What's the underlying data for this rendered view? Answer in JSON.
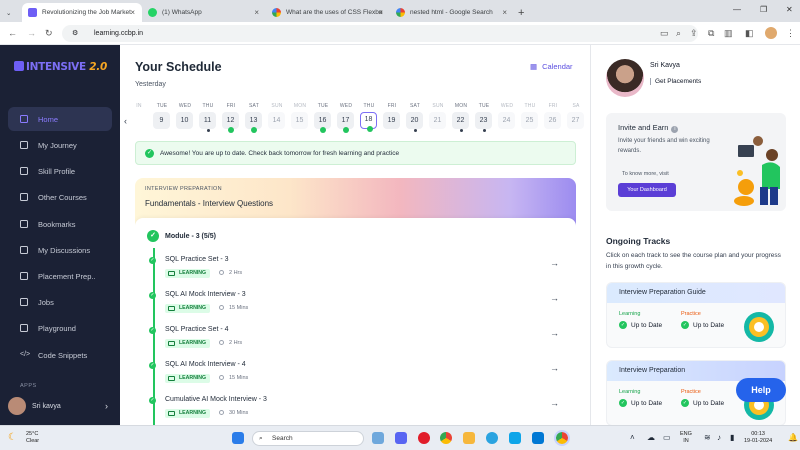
{
  "browser": {
    "tabs": [
      {
        "title": "Revolutionizing the Job Market",
        "icon": "ccbp-icon",
        "active": true
      },
      {
        "title": "(1) WhatsApp",
        "icon": "whatsapp-icon",
        "active": false
      },
      {
        "title": "What are the uses of CSS Flexbo",
        "icon": "google-icon",
        "active": false
      },
      {
        "title": "nested html - Google Search",
        "icon": "google-icon",
        "active": false
      }
    ],
    "url": "learning.ccbp.in"
  },
  "sidebar": {
    "brand": "INTENSIVE",
    "brand_version": "2.0",
    "items": [
      {
        "label": "Home",
        "icon": "home-icon"
      },
      {
        "label": "My Journey",
        "icon": "journey-icon"
      },
      {
        "label": "Skill Profile",
        "icon": "chart-icon"
      },
      {
        "label": "Other Courses",
        "icon": "book-icon"
      },
      {
        "label": "Bookmarks",
        "icon": "bookmark-icon"
      },
      {
        "label": "My Discussions",
        "icon": "chat-icon"
      },
      {
        "label": "Placement Prep..",
        "icon": "briefcase-icon"
      },
      {
        "label": "Jobs",
        "icon": "jobs-icon"
      },
      {
        "label": "Playground",
        "icon": "playground-icon"
      },
      {
        "label": "Code Snippets",
        "icon": "code-icon"
      }
    ],
    "apps_label": "APPS",
    "user_name": "Sri kavya"
  },
  "schedule": {
    "title": "Your Schedule",
    "subtitle": "Yesterday",
    "calendar_label": "Calendar",
    "days": [
      {
        "name": "IN",
        "num": "",
        "state": "dim"
      },
      {
        "name": "TUE",
        "num": "9",
        "state": "normal"
      },
      {
        "name": "WED",
        "num": "10",
        "state": "normal"
      },
      {
        "name": "THU",
        "num": "11",
        "state": "dot"
      },
      {
        "name": "FRI",
        "num": "12",
        "state": "check"
      },
      {
        "name": "SAT",
        "num": "13",
        "state": "check"
      },
      {
        "name": "SUN",
        "num": "14",
        "state": "dim"
      },
      {
        "name": "MON",
        "num": "15",
        "state": "dim"
      },
      {
        "name": "TUE",
        "num": "16",
        "state": "check"
      },
      {
        "name": "WED",
        "num": "17",
        "state": "check"
      },
      {
        "name": "THU",
        "num": "18",
        "state": "selected"
      },
      {
        "name": "FRI",
        "num": "19",
        "state": "normal"
      },
      {
        "name": "SAT",
        "num": "20",
        "state": "dot"
      },
      {
        "name": "SUN",
        "num": "21",
        "state": "dim"
      },
      {
        "name": "MON",
        "num": "22",
        "state": "dot"
      },
      {
        "name": "TUE",
        "num": "23",
        "state": "dot"
      },
      {
        "name": "WED",
        "num": "24",
        "state": "dim"
      },
      {
        "name": "THU",
        "num": "25",
        "state": "dim"
      },
      {
        "name": "FRI",
        "num": "26",
        "state": "dim"
      },
      {
        "name": "SA",
        "num": "27",
        "state": "dim"
      }
    ],
    "banner": "Awesome! You are up to date. Check back tomorrow for fresh learning and practice"
  },
  "card": {
    "eyebrow": "INTERVIEW PREPARATION",
    "title": "Fundamentals - Interview Questions",
    "module": "Module - 3 (5/5)",
    "items": [
      {
        "title": "SQL Practice Set - 3",
        "tag": "LEARNING",
        "duration": "2 Hrs"
      },
      {
        "title": "SQL AI Mock Interview - 3",
        "tag": "LEARNING",
        "duration": "15 Mins"
      },
      {
        "title": "SQL Practice Set - 4",
        "tag": "LEARNING",
        "duration": "2 Hrs"
      },
      {
        "title": "SQL AI Mock Interview - 4",
        "tag": "LEARNING",
        "duration": "15 Mins"
      },
      {
        "title": "Cumulative AI Mock Interview - 3",
        "tag": "LEARNING",
        "duration": "30 Mins"
      }
    ]
  },
  "profile": {
    "name": "Sri Kavya",
    "link": "Get Placements"
  },
  "invite": {
    "title": "Invite and Earn",
    "desc": "Invite your friends and win exciting rewards.",
    "know_more": "To know more, visit",
    "button": "Your Dashboard"
  },
  "tracks": {
    "title": "Ongoing Tracks",
    "desc": "Click on each track to see the course plan and your progress in this growth cycle.",
    "items": [
      {
        "name": "Interview Preparation Guide",
        "learning_label": "Learning",
        "learning_value": "Up to Date",
        "practice_label": "Practice",
        "practice_value": "Up to Date"
      },
      {
        "name": "Interview Preparation",
        "learning_label": "Learning",
        "learning_value": "Up to Date",
        "practice_label": "Practice",
        "practice_value": "Up to Date"
      }
    ]
  },
  "help_label": "Help",
  "taskbar": {
    "weather_temp": "25°C",
    "weather_desc": "Clear",
    "search_placeholder": "Search",
    "lang": "ENG",
    "region": "IN",
    "time": "00:13",
    "date": "19-01-2024"
  },
  "colors": {
    "accent": "#7c6ff5",
    "sidebar_bg": "#1b2135",
    "success": "#22c55e",
    "help": "#2563eb"
  }
}
